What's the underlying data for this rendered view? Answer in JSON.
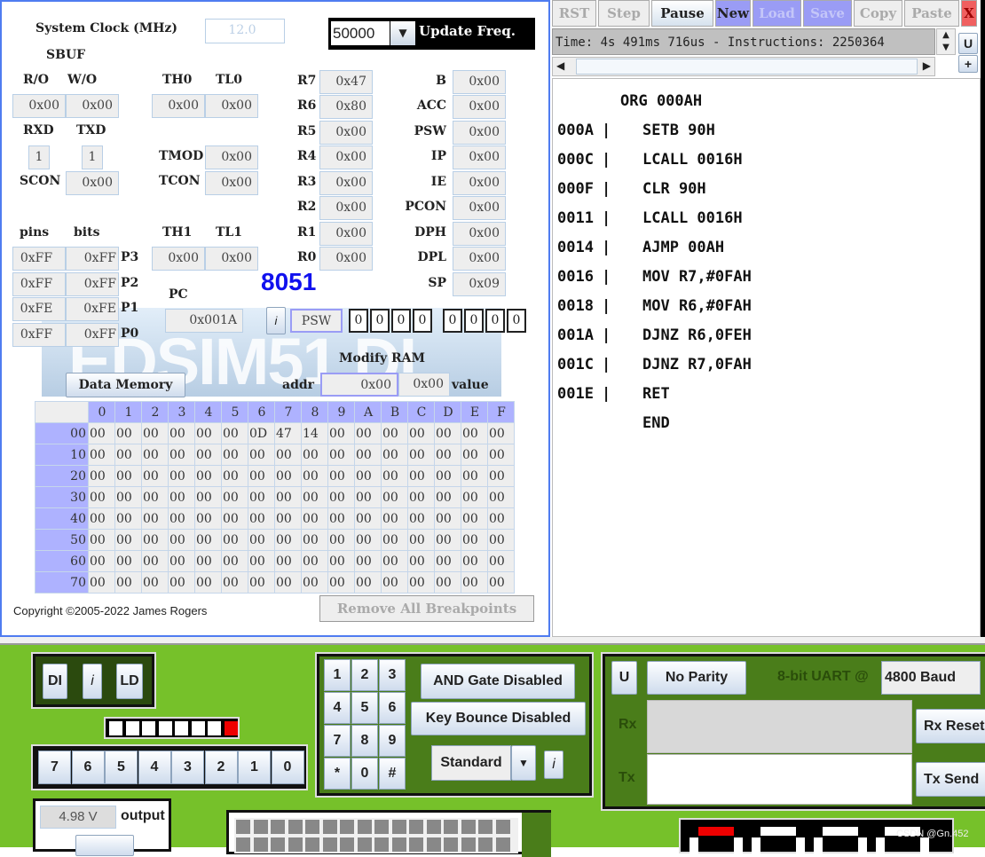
{
  "clock": {
    "label": "System Clock (MHz)",
    "value": "12.0"
  },
  "update": {
    "value": "50000",
    "label": "Update Freq."
  },
  "sbuf": {
    "label": "SBUF",
    "ro_label": "R/O",
    "wo_label": "W/O",
    "ro": "0x00",
    "wo": "0x00",
    "rxd_label": "RXD",
    "txd_label": "TXD",
    "rxd": "1",
    "txd": "1",
    "scon_label": "SCON",
    "scon": "0x00"
  },
  "timers": {
    "th0_label": "TH0",
    "tl0_label": "TL0",
    "th0": "0x00",
    "tl0": "0x00",
    "tmod_label": "TMOD",
    "tmod": "0x00",
    "tcon_label": "TCON",
    "tcon": "0x00",
    "th1_label": "TH1",
    "tl1_label": "TL1",
    "th1": "0x00",
    "tl1": "0x00"
  },
  "rregs": [
    {
      "name": "R7",
      "value": "0x47"
    },
    {
      "name": "R6",
      "value": "0x80"
    },
    {
      "name": "R5",
      "value": "0x00"
    },
    {
      "name": "R4",
      "value": "0x00"
    },
    {
      "name": "R3",
      "value": "0x00"
    },
    {
      "name": "R2",
      "value": "0x00"
    },
    {
      "name": "R1",
      "value": "0x00"
    },
    {
      "name": "R0",
      "value": "0x00"
    }
  ],
  "sfrs": [
    {
      "name": "B",
      "value": "0x00"
    },
    {
      "name": "ACC",
      "value": "0x00"
    },
    {
      "name": "PSW",
      "value": "0x00"
    },
    {
      "name": "IP",
      "value": "0x00"
    },
    {
      "name": "IE",
      "value": "0x00"
    },
    {
      "name": "PCON",
      "value": "0x00"
    },
    {
      "name": "DPH",
      "value": "0x00"
    },
    {
      "name": "DPL",
      "value": "0x00"
    },
    {
      "name": "SP",
      "value": "0x09"
    }
  ],
  "ports": {
    "pins_label": "pins",
    "bits_label": "bits",
    "rows": [
      {
        "name": "P3",
        "pins": "0xFF",
        "bits": "0xFF"
      },
      {
        "name": "P2",
        "pins": "0xFF",
        "bits": "0xFF"
      },
      {
        "name": "P1",
        "pins": "0xFE",
        "bits": "0xFE"
      },
      {
        "name": "P0",
        "pins": "0xFF",
        "bits": "0xFF"
      }
    ]
  },
  "chip": "8051",
  "pc": {
    "label": "PC",
    "value": "0x001A"
  },
  "info_label": "i",
  "psw": {
    "label": "PSW",
    "bits": [
      "0",
      "0",
      "0",
      "0",
      "0",
      "0",
      "0",
      "0"
    ]
  },
  "logo_text": "EDSIM51 DI",
  "modify_ram": {
    "label": "Modify RAM",
    "addr_label": "addr",
    "addr": "0x00",
    "value": "0x00",
    "value_label": "value"
  },
  "data_memory_button": "Data Memory",
  "memory": {
    "cols": [
      "0",
      "1",
      "2",
      "3",
      "4",
      "5",
      "6",
      "7",
      "8",
      "9",
      "A",
      "B",
      "C",
      "D",
      "E",
      "F"
    ],
    "rows": [
      {
        "addr": "00",
        "cells": [
          "00",
          "00",
          "00",
          "00",
          "00",
          "00",
          "0D",
          "47",
          "14",
          "00",
          "00",
          "00",
          "00",
          "00",
          "00",
          "00"
        ]
      },
      {
        "addr": "10",
        "cells": [
          "00",
          "00",
          "00",
          "00",
          "00",
          "00",
          "00",
          "00",
          "00",
          "00",
          "00",
          "00",
          "00",
          "00",
          "00",
          "00"
        ]
      },
      {
        "addr": "20",
        "cells": [
          "00",
          "00",
          "00",
          "00",
          "00",
          "00",
          "00",
          "00",
          "00",
          "00",
          "00",
          "00",
          "00",
          "00",
          "00",
          "00"
        ]
      },
      {
        "addr": "30",
        "cells": [
          "00",
          "00",
          "00",
          "00",
          "00",
          "00",
          "00",
          "00",
          "00",
          "00",
          "00",
          "00",
          "00",
          "00",
          "00",
          "00"
        ]
      },
      {
        "addr": "40",
        "cells": [
          "00",
          "00",
          "00",
          "00",
          "00",
          "00",
          "00",
          "00",
          "00",
          "00",
          "00",
          "00",
          "00",
          "00",
          "00",
          "00"
        ]
      },
      {
        "addr": "50",
        "cells": [
          "00",
          "00",
          "00",
          "00",
          "00",
          "00",
          "00",
          "00",
          "00",
          "00",
          "00",
          "00",
          "00",
          "00",
          "00",
          "00"
        ]
      },
      {
        "addr": "60",
        "cells": [
          "00",
          "00",
          "00",
          "00",
          "00",
          "00",
          "00",
          "00",
          "00",
          "00",
          "00",
          "00",
          "00",
          "00",
          "00",
          "00"
        ]
      },
      {
        "addr": "70",
        "cells": [
          "00",
          "00",
          "00",
          "00",
          "00",
          "00",
          "00",
          "00",
          "00",
          "00",
          "00",
          "00",
          "00",
          "00",
          "00",
          "00"
        ]
      }
    ]
  },
  "copyright": "Copyright ©2005-2022 James Rogers",
  "remove_breakpoints": "Remove All Breakpoints",
  "toolbar": [
    {
      "label": "RST",
      "w": 50,
      "style": "dis"
    },
    {
      "label": "Step",
      "w": 58,
      "style": "dis"
    },
    {
      "label": "Pause",
      "w": 70,
      "style": "on"
    },
    {
      "label": "New",
      "w": 40,
      "style": "blue"
    },
    {
      "label": "Load",
      "w": 55,
      "style": "bluedis"
    },
    {
      "label": "Save",
      "w": 55,
      "style": "bluedis"
    },
    {
      "label": "Copy",
      "w": 55,
      "style": "dis"
    },
    {
      "label": "Paste",
      "w": 62,
      "style": "dis"
    },
    {
      "label": "X",
      "w": 18,
      "style": "red"
    }
  ],
  "status": "Time: 4s 491ms 716us - Instructions: 2250364",
  "side_buttons": [
    "U",
    "+"
  ],
  "code": [
    {
      "addr": "",
      "text": "ORG 000AH"
    },
    {
      "addr": "000A",
      "text": "SETB 90H"
    },
    {
      "addr": "000C",
      "text": "LCALL 0016H"
    },
    {
      "addr": "000F",
      "text": "CLR 90H"
    },
    {
      "addr": "0011",
      "text": "LCALL 0016H"
    },
    {
      "addr": "0014",
      "text": "AJMP 00AH"
    },
    {
      "addr": "0016",
      "text": "MOV R7,#0FAH"
    },
    {
      "addr": "0018",
      "text": "MOV R6,#0FAH"
    },
    {
      "addr": "001A",
      "text": "DJNZ R6,0FEH"
    },
    {
      "addr": "001C",
      "text": "DJNZ R7,0FAH"
    },
    {
      "addr": "001E",
      "text": "RET"
    },
    {
      "addr": "",
      "text": "END"
    }
  ],
  "board": {
    "di": "DI",
    "i": "i",
    "ld": "LD",
    "leds": [
      0,
      0,
      0,
      0,
      0,
      0,
      0,
      1
    ],
    "switches": [
      "7",
      "6",
      "5",
      "4",
      "3",
      "2",
      "1",
      "0"
    ],
    "voltage": "4.98 V",
    "output_label": "output",
    "keys": [
      "1",
      "2",
      "3",
      "4",
      "5",
      "6",
      "7",
      "8",
      "9",
      "*",
      "0",
      "#"
    ],
    "and_gate": "AND Gate Disabled",
    "key_bounce": "Key Bounce Disabled",
    "keypad_mode": "Standard",
    "uart": {
      "u": "U",
      "parity": "No Parity",
      "label": "8-bit UART @",
      "baud": "4800 Baud",
      "rx_label": "Rx",
      "tx_label": "Tx",
      "rx_reset": "Rx Reset",
      "tx_send": "Tx Send"
    }
  },
  "colors": {
    "board_green": "#76c12a",
    "panel_green": "#4a7d1a",
    "accent_blue": "#1111ee",
    "led_on": "#ee0000",
    "header_purple": "#aeb2ff"
  },
  "watermark": "CSDN @Gn.452"
}
